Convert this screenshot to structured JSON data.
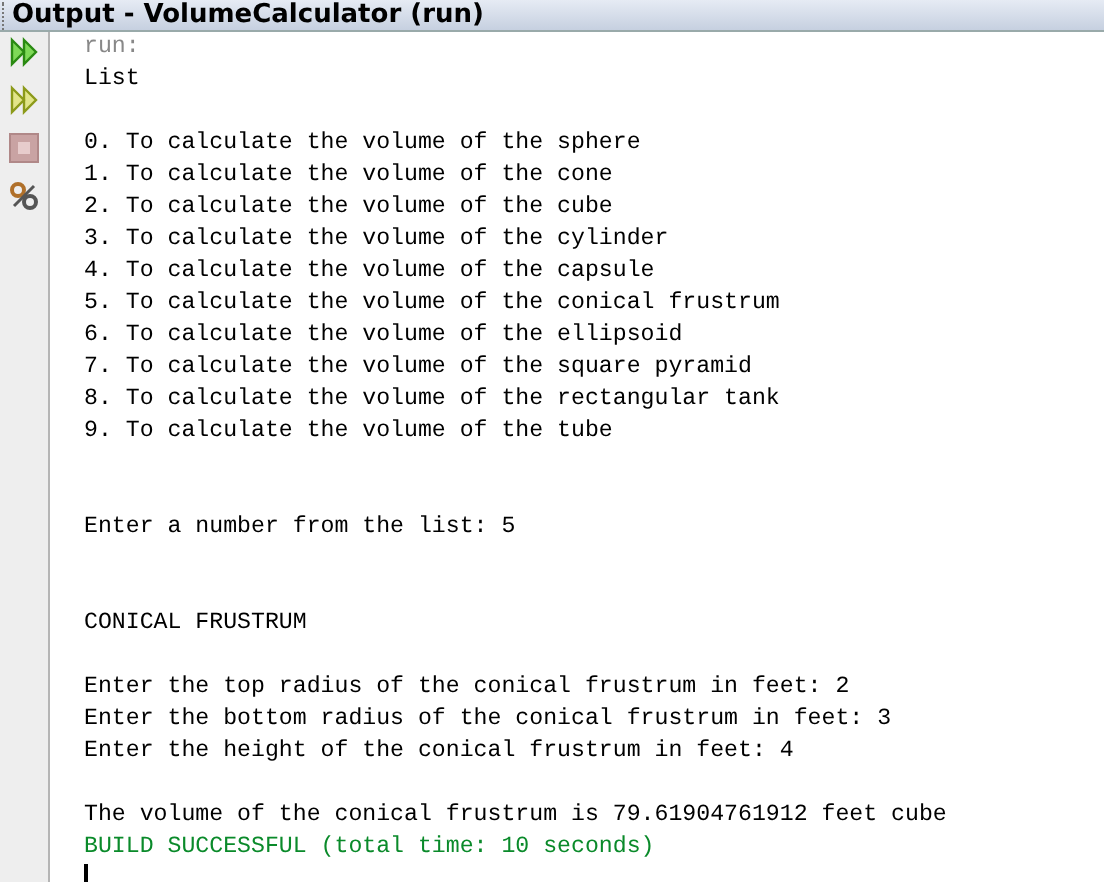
{
  "window": {
    "title": "Output - VolumeCalculator (run)"
  },
  "output_lines": [
    {
      "kind": "system",
      "text": "run:"
    },
    {
      "kind": "text",
      "text": "List"
    },
    {
      "kind": "blank"
    },
    {
      "kind": "text",
      "text": "0. To calculate the volume of the sphere"
    },
    {
      "kind": "text",
      "text": "1. To calculate the volume of the cone"
    },
    {
      "kind": "text",
      "text": "2. To calculate the volume of the cube"
    },
    {
      "kind": "text",
      "text": "3. To calculate the volume of the cylinder"
    },
    {
      "kind": "text",
      "text": "4. To calculate the volume of the capsule"
    },
    {
      "kind": "text",
      "text": "5. To calculate the volume of the conical frustrum"
    },
    {
      "kind": "text",
      "text": "6. To calculate the volume of the ellipsoid"
    },
    {
      "kind": "text",
      "text": "7. To calculate the volume of the square pyramid"
    },
    {
      "kind": "text",
      "text": "8. To calculate the volume of the rectangular tank"
    },
    {
      "kind": "text",
      "text": "9. To calculate the volume of the tube"
    },
    {
      "kind": "blank"
    },
    {
      "kind": "blank"
    },
    {
      "kind": "text",
      "text": "Enter a number from the list: 5"
    },
    {
      "kind": "blank"
    },
    {
      "kind": "blank"
    },
    {
      "kind": "text",
      "text": "CONICAL FRUSTRUM"
    },
    {
      "kind": "blank"
    },
    {
      "kind": "text",
      "text": "Enter the top radius of the conical frustrum in feet: 2"
    },
    {
      "kind": "text",
      "text": "Enter the bottom radius of the conical frustrum in feet: 3"
    },
    {
      "kind": "text",
      "text": "Enter the height of the conical frustrum in feet: 4"
    },
    {
      "kind": "blank"
    },
    {
      "kind": "text",
      "text": "The volume of the conical frustrum is 79.61904761912 feet cube"
    },
    {
      "kind": "success",
      "text": "BUILD SUCCESSFUL (total time: 10 seconds)"
    }
  ]
}
